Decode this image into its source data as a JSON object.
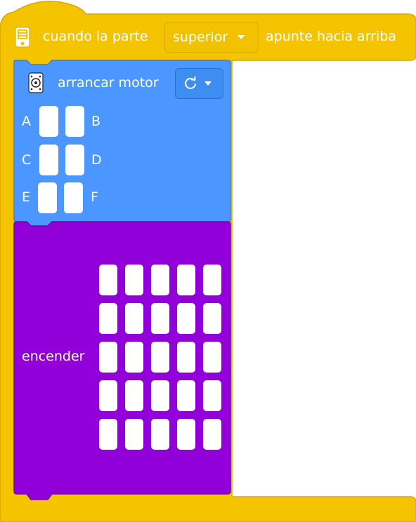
{
  "hat_block": {
    "prefix_text": "cuando la parte",
    "face_dropdown": {
      "selected": "superior"
    },
    "suffix_text": "apunte hacia arriba",
    "icon": "hub-icon",
    "color": "#f4c400"
  },
  "motor_block": {
    "label": "arrancar motor",
    "icon": "motor-icon",
    "direction_dropdown": {
      "selected_icon": "rotate-clockwise-icon"
    },
    "ports": [
      {
        "left": "A",
        "right": "B"
      },
      {
        "left": "C",
        "right": "D"
      },
      {
        "left": "E",
        "right": "F"
      }
    ],
    "color": "#4c97ff"
  },
  "light_block": {
    "label": "encender",
    "grid_rows": 5,
    "grid_cols": 5,
    "color": "#9100d8"
  }
}
